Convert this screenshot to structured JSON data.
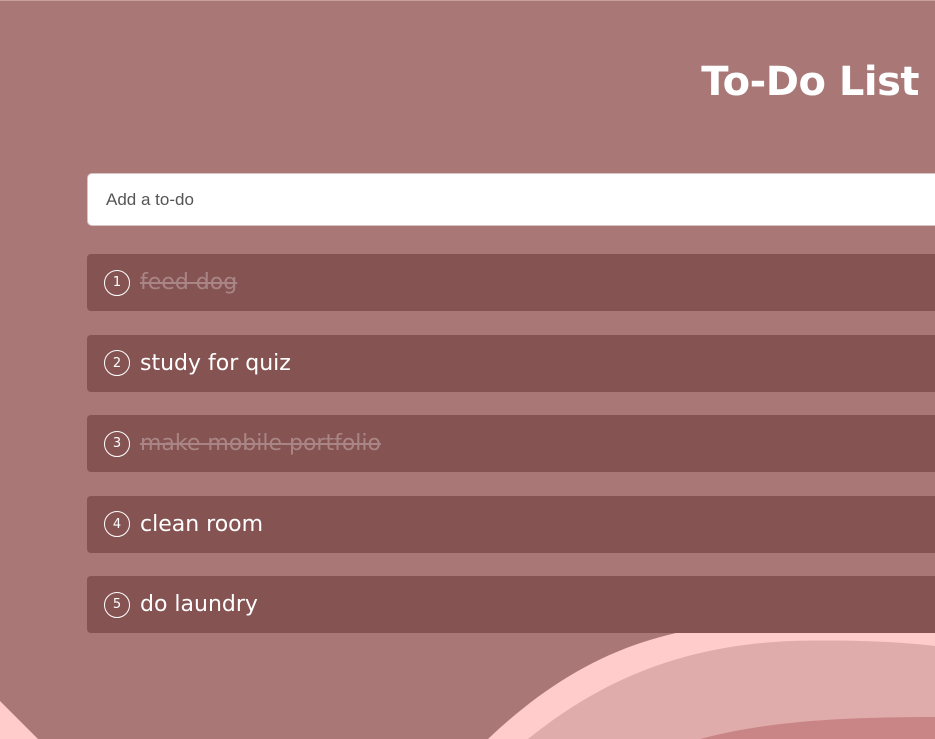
{
  "header": {
    "title": "To-Do List"
  },
  "input": {
    "placeholder": "Add a to-do",
    "value": ""
  },
  "todos": [
    {
      "number": "1",
      "text": "feed dog",
      "completed": true
    },
    {
      "number": "2",
      "text": "study for quiz",
      "completed": false
    },
    {
      "number": "3",
      "text": "make mobile portfolio",
      "completed": true
    },
    {
      "number": "4",
      "text": "clean room",
      "completed": false
    },
    {
      "number": "5",
      "text": "do laundry",
      "completed": false
    }
  ],
  "colors": {
    "background": "#a87776",
    "item_background": "#855352",
    "completed_text": "#a98685",
    "wave_light": "#ffcccb",
    "wave_mid": "#e0abab",
    "wave_dark": "#c98585"
  }
}
